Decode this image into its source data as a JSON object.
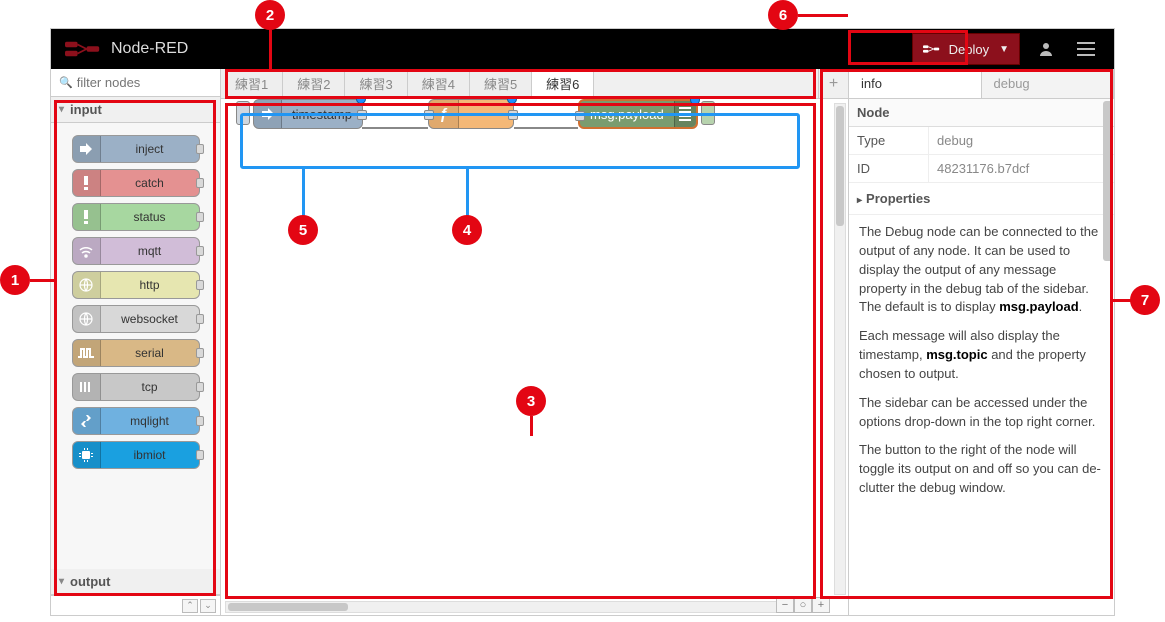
{
  "app_title": "Node-RED",
  "filter_placeholder": "filter nodes",
  "palette": {
    "cat_input": "input",
    "cat_output": "output",
    "nodes": [
      {
        "label": "inject",
        "bg": "#9bb0c6",
        "icon": "arrow"
      },
      {
        "label": "catch",
        "bg": "#e49191",
        "icon": "bang"
      },
      {
        "label": "status",
        "bg": "#a7d7a0",
        "icon": "bang"
      },
      {
        "label": "mqtt",
        "bg": "#d1bdd8",
        "icon": "wifi"
      },
      {
        "label": "http",
        "bg": "#e6e6b0",
        "icon": "globe"
      },
      {
        "label": "websocket",
        "bg": "#d8d8d8",
        "icon": "globe"
      },
      {
        "label": "serial",
        "bg": "#d9b886",
        "icon": "pulse"
      },
      {
        "label": "tcp",
        "bg": "#c8c8c8",
        "icon": "bars"
      },
      {
        "label": "mqlight",
        "bg": "#6fb1e0",
        "icon": "swap"
      },
      {
        "label": "ibmiot",
        "bg": "#1aa0e0",
        "icon": "chip"
      }
    ]
  },
  "tabs": [
    "練習1",
    "練習2",
    "練習3",
    "練習4",
    "練習5",
    "練習6"
  ],
  "active_tab": 5,
  "flow": {
    "inject_label": "timestamp",
    "debug_label": "msg.payload"
  },
  "deploy_label": "Deploy",
  "sidebar": {
    "tabs": [
      "info",
      "debug"
    ],
    "active": 0,
    "section": "Node",
    "type_k": "Type",
    "type_v": "debug",
    "id_k": "ID",
    "id_v": "48231176.b7dcf",
    "properties": "Properties",
    "desc": [
      "The Debug node can be connected to the output of any node. It can be used to display the output of any message property in the debug tab of the sidebar. The default is to display <b>msg.payload</b>.",
      "Each message will also display the timestamp, <b>msg.topic</b> and the property chosen to output.",
      "The sidebar can be accessed under the options drop-down in the top right corner.",
      "The button to the right of the node will toggle its output on and off so you can de-clutter the debug window."
    ]
  },
  "callouts": {
    "1": "1",
    "2": "2",
    "3": "3",
    "4": "4",
    "5": "5",
    "6": "6",
    "7": "7"
  }
}
